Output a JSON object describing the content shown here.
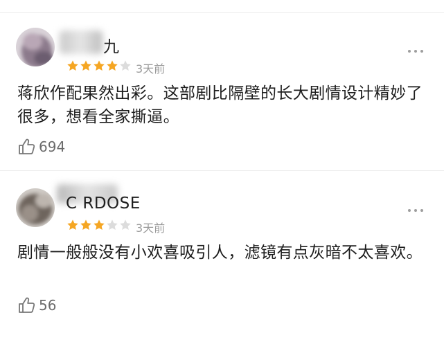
{
  "reviews": [
    {
      "username": "九",
      "rating": 4,
      "max_rating": 5,
      "time": "3天前",
      "content": "蒋欣作配果然出彩。这部剧比隔壁的长大剧情设计精妙了很多，想看全家撕逼。",
      "likes": "694",
      "star_color": "#f5a623",
      "star_empty_color": "#dcdcdc"
    },
    {
      "username": "C  RDOSE",
      "rating": 3,
      "max_rating": 5,
      "time": "3天前",
      "content": "剧情一般般没有小欢喜吸引人，滤镜有点灰暗不太喜欢。",
      "likes": "56",
      "star_color": "#f5a623",
      "star_empty_color": "#dcdcdc"
    }
  ]
}
